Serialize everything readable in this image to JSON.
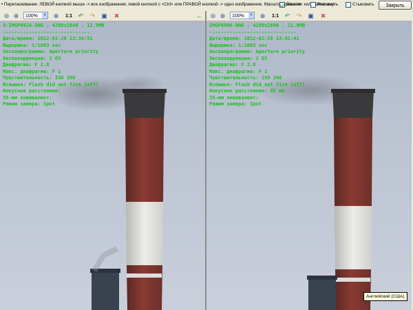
{
  "hint_text": "• Перетаскивание: ЛЕВОЙ кнопкой мыши -> все изображения; левой кнопкой с <Ctrl> или ПРАВОЙ кнопкой -> одно изображение. Масштабирование: колесом мыши",
  "options": {
    "sync_label": "Вместе",
    "stretch_label": "Растянуть",
    "stack_label": "Стыковать",
    "sync_checked": true,
    "stretch_checked": false,
    "stack_checked": false
  },
  "close_label": "Закрыть",
  "toolbar": {
    "zoom_value": "100%",
    "one_to_one": "1:1"
  },
  "left": {
    "file": "3-IMGP8924.DNG , 4288x2848 , 12.9MB",
    "sep": "------------------------------",
    "date": "Дата/время: 2012-02-28 13:34:51",
    "exposure": "Выдержка: 1/1603 sec",
    "program": "Экспопрограмма: Aperture priority",
    "comp": "Экспокоррекция: 2 EV",
    "aperture": "Диафрагма: F 2.8",
    "max_aperture": "Макс. диафрагма: F 1",
    "iso": "Чувствительность: ISO 200",
    "flash": "Вспышка: Flash did not fire [off]",
    "focal": "Фокусное расстояние:",
    "focal35": "35-мм эквивалент:",
    "metering": "Режим замера: Spot"
  },
  "right": {
    "file": "IMGP8906.DNG , 4288x2848 , 12.9MB",
    "sep": "------------------------------",
    "date": "Дата/время: 2012-02-28 13:01:41",
    "exposure": "Выдержка: 1/1603 sec",
    "program": "Экспопрограмма: Aperture priority",
    "comp": "Экспокоррекция: 2 EV",
    "aperture": "Диафрагма: F 2.8",
    "max_aperture": "Макс. диафрагма: F 1",
    "iso": "Чувствительность: ISO 200",
    "flash": "Вспышка: Flash did not fire [off]",
    "focal": "Фокусное расстояние: 85 mm",
    "focal35": "35-мм эквивалент:",
    "metering": "Режим замера: Spot"
  },
  "tooltip": "Английский (США)",
  "colors": {
    "exif_text": "#16c416",
    "sky": "#bcc4d2",
    "chimney_red": "#8a3a32",
    "chimney_white": "#e8e8e4"
  }
}
